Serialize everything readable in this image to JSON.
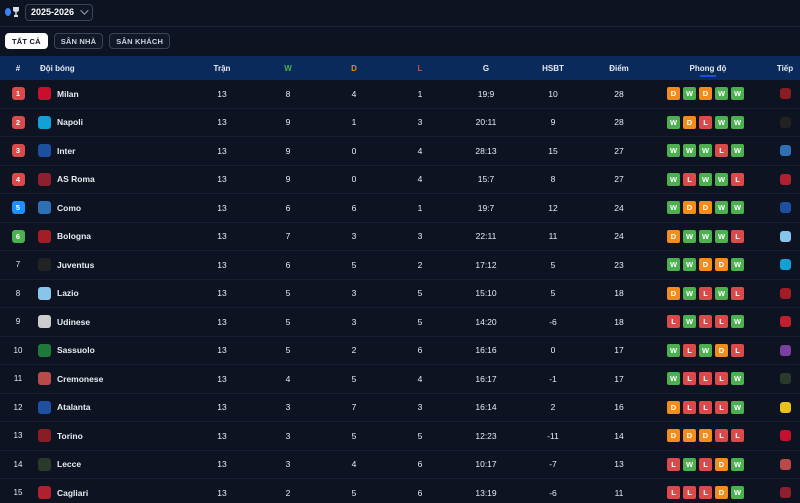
{
  "header": {
    "season": "2025-2026"
  },
  "tabs": [
    {
      "label": "TẤT CẢ",
      "active": true
    },
    {
      "label": "SÂN NHÀ",
      "active": false
    },
    {
      "label": "SÂN KHÁCH",
      "active": false
    }
  ],
  "columns": {
    "rank": "#",
    "team": "Đội bóng",
    "played": "Trận",
    "won": "W",
    "drawn": "D",
    "lost": "L",
    "goals": "G",
    "gd": "HSBT",
    "points": "Điểm",
    "form": "Phong độ",
    "next": "Tiếp"
  },
  "column_colors": {
    "won": "#4caf50",
    "drawn": "#f28c1a",
    "lost": "#d94a4a"
  },
  "rank_colors": {
    "ucl": "#d94a4a",
    "uel": "#1e90ff",
    "uecl": "#4caf50"
  },
  "rows": [
    {
      "rank": "1",
      "zone": "ucl",
      "team": "Milan",
      "crest": "#c8102e",
      "played": "13",
      "w": "8",
      "d": "4",
      "l": "1",
      "g": "19:9",
      "gd": "10",
      "pts": "28",
      "form": [
        "D",
        "W",
        "D",
        "W",
        "W"
      ],
      "next": "torino-crest"
    },
    {
      "rank": "2",
      "zone": "ucl",
      "team": "Napoli",
      "crest": "#12a0d7",
      "played": "13",
      "w": "9",
      "d": "1",
      "l": "3",
      "g": "20:11",
      "gd": "9",
      "pts": "28",
      "form": [
        "W",
        "D",
        "L",
        "W",
        "W"
      ],
      "next": "juventus-crest"
    },
    {
      "rank": "3",
      "zone": "ucl",
      "team": "Inter",
      "crest": "#1c4fa0",
      "played": "13",
      "w": "9",
      "d": "0",
      "l": "4",
      "g": "28:13",
      "gd": "15",
      "pts": "27",
      "form": [
        "W",
        "W",
        "W",
        "L",
        "W"
      ],
      "next": "como-crest"
    },
    {
      "rank": "4",
      "zone": "ucl",
      "team": "AS Roma",
      "crest": "#8e1f2f",
      "played": "13",
      "w": "9",
      "d": "0",
      "l": "4",
      "g": "15:7",
      "gd": "8",
      "pts": "27",
      "form": [
        "W",
        "L",
        "W",
        "W",
        "L"
      ],
      "next": "cagliari-crest"
    },
    {
      "rank": "5",
      "zone": "uel",
      "team": "Como",
      "crest": "#2f6fb5",
      "played": "13",
      "w": "6",
      "d": "6",
      "l": "1",
      "g": "19:7",
      "gd": "12",
      "pts": "24",
      "form": [
        "W",
        "D",
        "D",
        "W",
        "W"
      ],
      "next": "inter-crest"
    },
    {
      "rank": "6",
      "zone": "uecl",
      "team": "Bologna",
      "crest": "#a21c26",
      "played": "13",
      "w": "7",
      "d": "3",
      "l": "3",
      "g": "22:11",
      "gd": "11",
      "pts": "24",
      "form": [
        "D",
        "W",
        "W",
        "W",
        "L"
      ],
      "next": "lazio-crest"
    },
    {
      "rank": "7",
      "zone": "",
      "team": "Juventus",
      "crest": "#222222",
      "played": "13",
      "w": "6",
      "d": "5",
      "l": "2",
      "g": "17:12",
      "gd": "5",
      "pts": "23",
      "form": [
        "W",
        "W",
        "D",
        "D",
        "W"
      ],
      "next": "napoli-crest"
    },
    {
      "rank": "8",
      "zone": "",
      "team": "Lazio",
      "crest": "#87c5ea",
      "played": "13",
      "w": "5",
      "d": "3",
      "l": "5",
      "g": "15:10",
      "gd": "5",
      "pts": "18",
      "form": [
        "D",
        "W",
        "L",
        "W",
        "L"
      ],
      "next": "bologna-crest"
    },
    {
      "rank": "9",
      "zone": "",
      "team": "Udinese",
      "crest": "#cccccc",
      "played": "13",
      "w": "5",
      "d": "3",
      "l": "5",
      "g": "14:20",
      "gd": "-6",
      "pts": "18",
      "form": [
        "L",
        "W",
        "L",
        "L",
        "W"
      ],
      "next": "genoa-crest"
    },
    {
      "rank": "10",
      "zone": "",
      "team": "Sassuolo",
      "crest": "#1f7a3a",
      "played": "13",
      "w": "5",
      "d": "2",
      "l": "6",
      "g": "16:16",
      "gd": "0",
      "pts": "17",
      "form": [
        "W",
        "L",
        "W",
        "D",
        "L"
      ],
      "next": "fiorentina-crest"
    },
    {
      "rank": "11",
      "zone": "",
      "team": "Cremonese",
      "crest": "#b84a4a",
      "played": "13",
      "w": "4",
      "d": "5",
      "l": "4",
      "g": "16:17",
      "gd": "-1",
      "pts": "17",
      "form": [
        "W",
        "L",
        "L",
        "L",
        "W"
      ],
      "next": "lecce-crest"
    },
    {
      "rank": "12",
      "zone": "",
      "team": "Atalanta",
      "crest": "#1e4fa0",
      "played": "13",
      "w": "3",
      "d": "7",
      "l": "3",
      "g": "16:14",
      "gd": "2",
      "pts": "16",
      "form": [
        "D",
        "L",
        "L",
        "L",
        "W"
      ],
      "next": "verona-crest"
    },
    {
      "rank": "13",
      "zone": "",
      "team": "Torino",
      "crest": "#8a1c24",
      "played": "13",
      "w": "3",
      "d": "5",
      "l": "5",
      "g": "12:23",
      "gd": "-11",
      "pts": "14",
      "form": [
        "D",
        "D",
        "D",
        "L",
        "L"
      ],
      "next": "milan-crest"
    },
    {
      "rank": "14",
      "zone": "",
      "team": "Lecce",
      "crest": "#2a3a2a",
      "played": "13",
      "w": "3",
      "d": "4",
      "l": "6",
      "g": "10:17",
      "gd": "-7",
      "pts": "13",
      "form": [
        "L",
        "W",
        "L",
        "D",
        "W"
      ],
      "next": "cremonese-crest"
    },
    {
      "rank": "15",
      "zone": "",
      "team": "Cagliari",
      "crest": "#b0202e",
      "played": "13",
      "w": "2",
      "d": "5",
      "l": "6",
      "g": "13:19",
      "gd": "-6",
      "pts": "11",
      "form": [
        "L",
        "L",
        "L",
        "D",
        "W"
      ],
      "next": "roma-crest"
    }
  ]
}
